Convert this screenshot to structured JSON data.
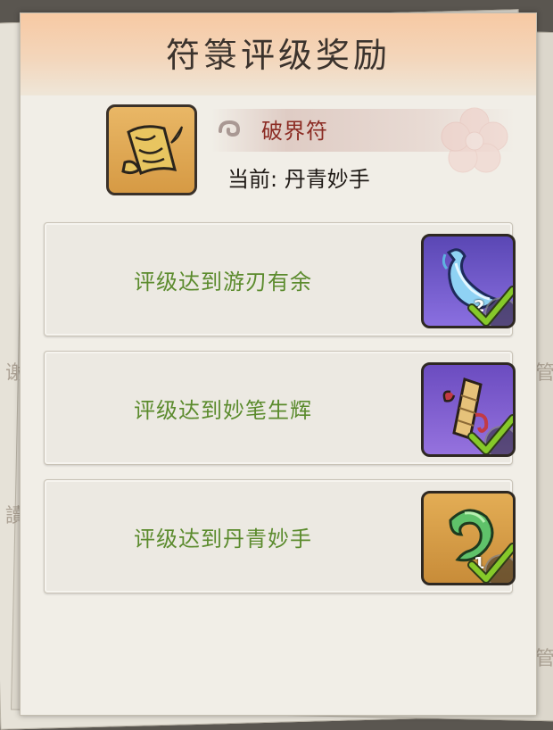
{
  "title": "符箓评级奖励",
  "item": {
    "name": "破界符",
    "icon": "scroll-talisman-icon",
    "current_label": "当前:",
    "current_value": "丹青妙手"
  },
  "rewards": [
    {
      "label": "评级达到游刃有余",
      "icon": "blue-ribbon-blade-icon",
      "count": "2",
      "claimed": true,
      "bg": "#6a4fc4"
    },
    {
      "label": "评级达到妙笔生辉",
      "icon": "scroll-bundle-icon",
      "count": "",
      "claimed": true,
      "bg": "#7d56c9"
    },
    {
      "label": "评级达到丹青妙手",
      "icon": "jade-swirl-icon",
      "count": "1",
      "claimed": true,
      "bg": "#d7a04a"
    }
  ],
  "colors": {
    "label_green": "#5b8b2d",
    "item_name_red": "#8b2b23",
    "check_green": "#7fc22a"
  }
}
